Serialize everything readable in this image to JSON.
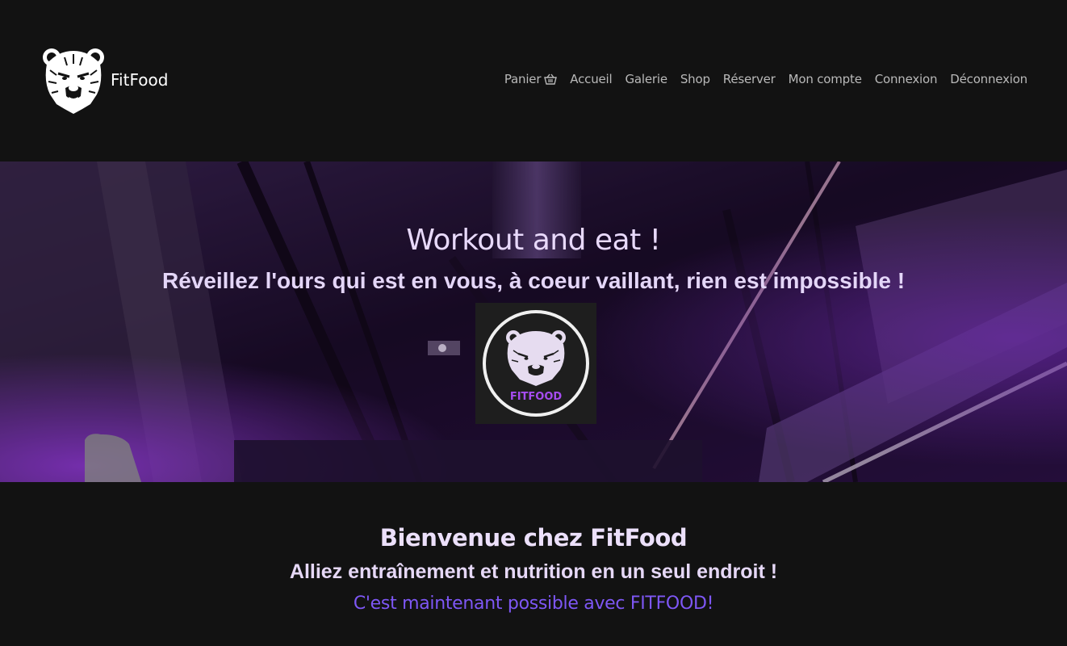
{
  "header": {
    "brand_name": "FitFood",
    "logo_icon": "bear-head-icon"
  },
  "nav": {
    "items": [
      {
        "label": "Panier",
        "icon": "basket-icon"
      },
      {
        "label": "Accueil"
      },
      {
        "label": "Galerie"
      },
      {
        "label": "Shop"
      },
      {
        "label": "Réserver"
      },
      {
        "label": "Mon compte"
      },
      {
        "label": "Connexion"
      },
      {
        "label": "Déconnexion"
      }
    ]
  },
  "hero": {
    "title": "Workout and eat !",
    "subtitle": "Réveillez l'ours qui est en vous, à coeur vaillant, rien est impossible !",
    "badge_text": "FITFOOD",
    "background": "gym-ceiling-purple-lights"
  },
  "welcome": {
    "title": "Bienvenue chez FitFood",
    "subtitle": "Alliez entraînement et nutrition en un seul endroit !",
    "accent": "C'est maintenant possible avec FITFOOD!"
  },
  "colors": {
    "page_bg": "#121212",
    "accent": "#7e57f5",
    "hero_text": "#e8d9fb",
    "nav_text": "#b9b9b9",
    "badge_text": "#a64cf0"
  }
}
